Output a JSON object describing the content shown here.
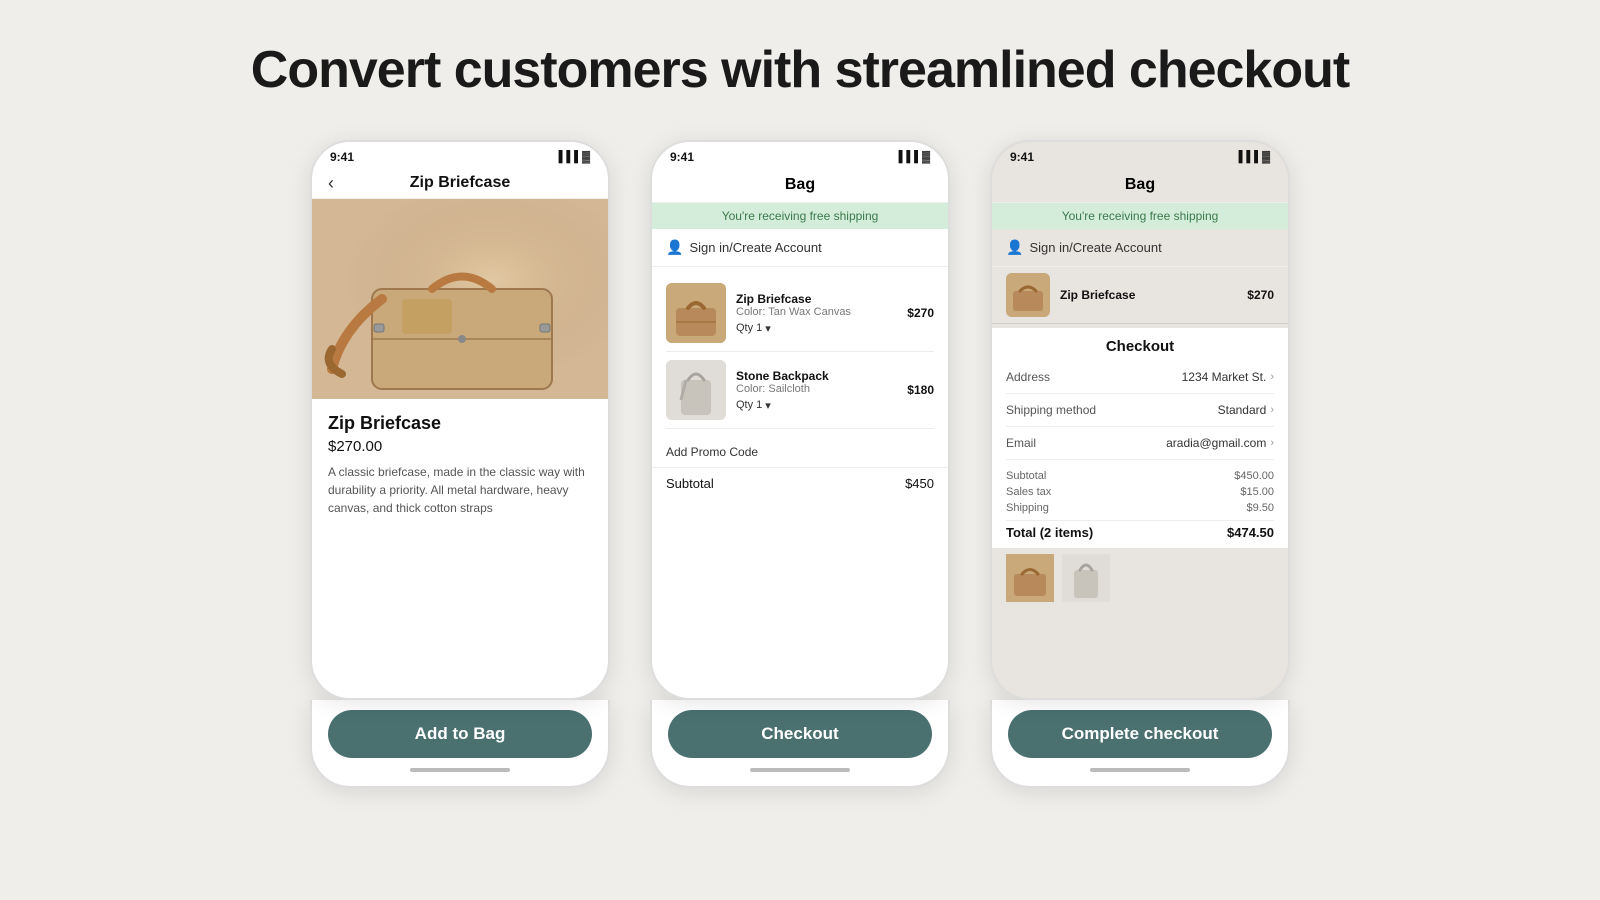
{
  "page": {
    "title": "Convert customers with streamlined checkout"
  },
  "phone1": {
    "status_time": "9:41",
    "nav_title": "Zip Briefcase",
    "back_icon": "‹",
    "product_name": "Zip Briefcase",
    "product_price": "$270.00",
    "product_desc": "A classic briefcase, made in the classic way with durability a priority. All metal hardware, heavy canvas, and thick cotton straps",
    "cta_label": "Add to Bag"
  },
  "phone2": {
    "status_time": "9:41",
    "header_title": "Bag",
    "free_shipping_text": "You're receiving free shipping",
    "sign_in_text": "Sign in/Create Account",
    "item1_name": "Zip Briefcase",
    "item1_color": "Color: Tan Wax Canvas",
    "item1_price": "$270",
    "item1_qty": "Qty 1",
    "item2_name": "Stone Backpack",
    "item2_color": "Color: Sailcloth",
    "item2_price": "$180",
    "item2_qty": "Qty 1",
    "promo_label": "Add Promo Code",
    "subtotal_label": "Subtotal",
    "subtotal_value": "$450",
    "cta_label": "Checkout"
  },
  "phone3": {
    "status_time": "9:41",
    "header_title": "Bag",
    "free_shipping_text": "You're receiving free shipping",
    "sign_in_text": "Sign in/Create Account",
    "item_name": "Zip Briefcase",
    "item_price": "$270",
    "checkout_title": "Checkout",
    "address_label": "Address",
    "address_value": "1234 Market St.",
    "shipping_label": "Shipping method",
    "shipping_value": "Standard",
    "email_label": "Email",
    "email_value": "aradia@gmail.com",
    "subtotal_label": "Subtotal",
    "subtotal_value": "$450.00",
    "tax_label": "Sales tax",
    "tax_value": "$15.00",
    "shipping_cost_label": "Shipping",
    "shipping_cost_value": "$9.50",
    "total_label": "Total (2 items)",
    "total_value": "$474.50",
    "cta_label": "Complete checkout"
  }
}
